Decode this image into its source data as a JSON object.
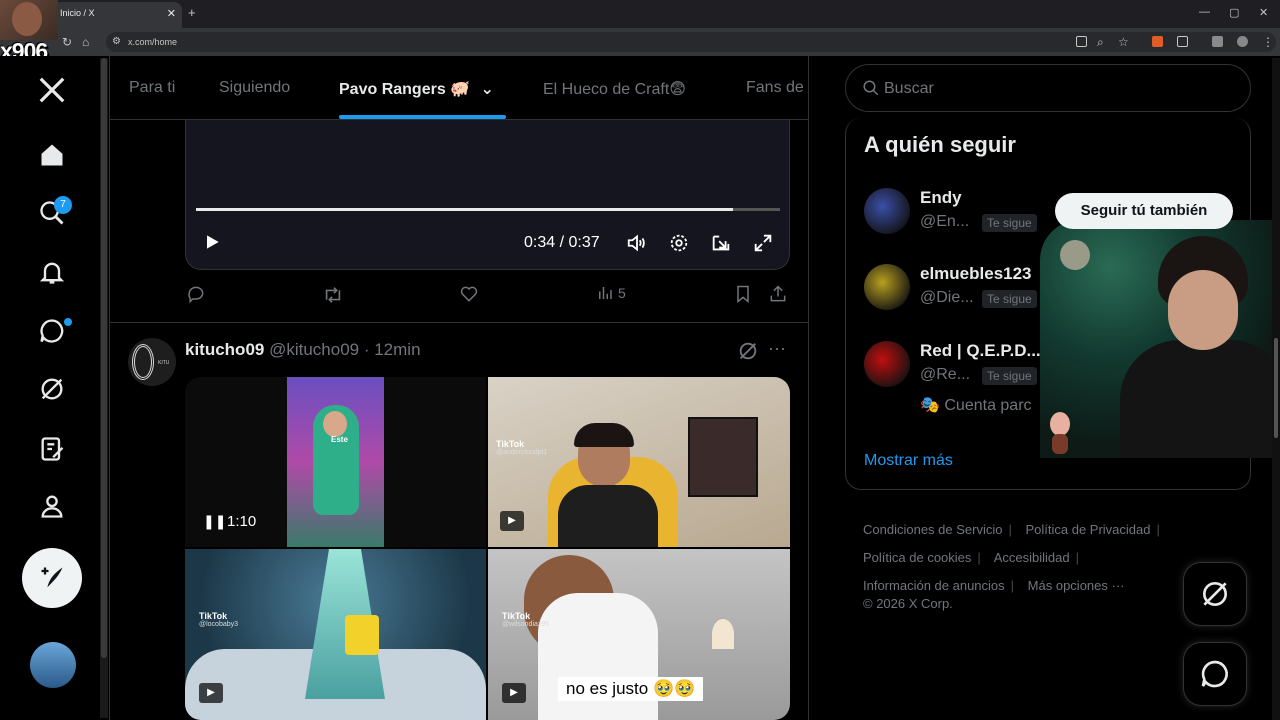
{
  "browser": {
    "tab_title": "Inicio / X",
    "url": "x.com/home"
  },
  "overlay": {
    "stream_tag": "x906"
  },
  "sidebar": {
    "notifications_badge": "7",
    "icons": [
      "x-logo-icon",
      "home-icon",
      "search-icon",
      "notifications-icon",
      "messages-icon",
      "grok-icon",
      "lists-icon",
      "profile-icon",
      "more-icon"
    ]
  },
  "feed": {
    "tabs": [
      {
        "label": "Para ti"
      },
      {
        "label": "Siguiendo"
      },
      {
        "label": "Pavo Rangers 🐖"
      },
      {
        "label": "El Hueco de Craft😨"
      },
      {
        "label": "Fans de"
      }
    ],
    "active_tab_index": 2,
    "video": {
      "time": "0:34 / 0:37",
      "progress": 0.92
    },
    "post_views": "5",
    "tweet": {
      "name": "kitucho09",
      "handle_time": "@kitucho09 · 12min",
      "avatar_text": "KITU",
      "media": [
        {
          "overlay_time": "1:10",
          "label": "Este"
        },
        {
          "tiktok": "TikTok",
          "user": "@andercloudpl1"
        },
        {
          "tiktok": "TikTok",
          "user": "@locobaby3"
        },
        {
          "tiktok": "TikTok",
          "user": "@wilsondiaz95",
          "caption": "no es justo 🥹🥹"
        }
      ]
    }
  },
  "right": {
    "search_placeholder": "Buscar",
    "who_to_follow": {
      "title": "A quién seguir",
      "users": [
        {
          "name": "Endy",
          "handle": "@En...",
          "tag": "Te sigue",
          "color": "#3b4fa8"
        },
        {
          "name": "elmuebles123",
          "handle": "@Die...",
          "tag": "Te sigue",
          "color": "#b8a020"
        },
        {
          "name": "Red | Q.E.P.D...",
          "handle": "@Re...",
          "tag": "Te sigue",
          "bio": "🎭 Cuenta parc",
          "color": "#c01010"
        }
      ],
      "follow_button": "Seguir tú también",
      "show_more": "Mostrar más"
    },
    "footer": {
      "links": [
        "Condiciones de Servicio",
        "Política de Privacidad",
        "Política de cookies",
        "Accesibilidad",
        "Información de anuncios",
        "Más opciones ···"
      ],
      "copyright": "© 2026 X Corp."
    }
  },
  "colors": {
    "accent": "#1d9bf0",
    "background": "#000000",
    "text": "#e7e9ea",
    "muted": "#71767b"
  }
}
